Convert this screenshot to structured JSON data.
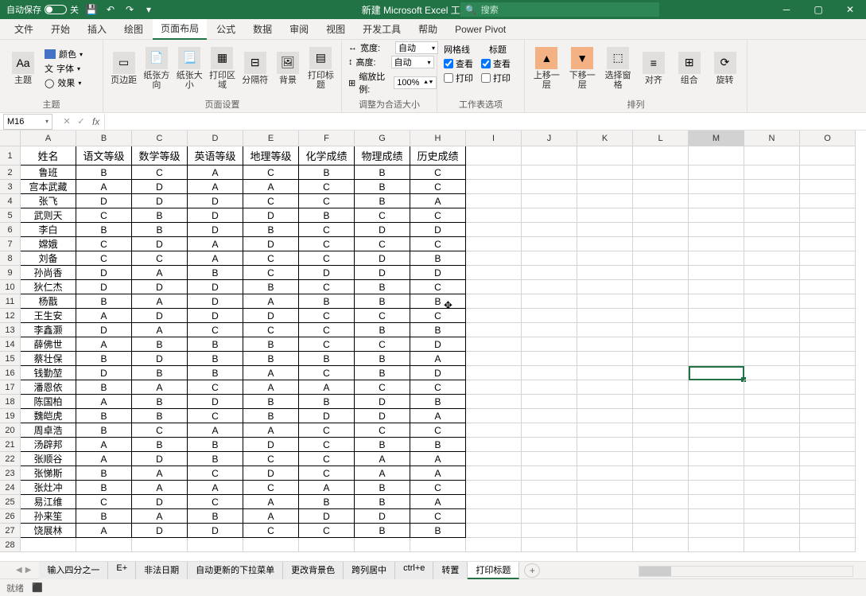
{
  "titlebar": {
    "autosave_label": "自动保存",
    "autosave_state": "关",
    "title": "新建 Microsoft Excel 工作表.xlsx  •",
    "search_placeholder": "搜索"
  },
  "menu": {
    "items": [
      "文件",
      "开始",
      "插入",
      "绘图",
      "页面布局",
      "公式",
      "数据",
      "审阅",
      "视图",
      "开发工具",
      "帮助",
      "Power Pivot"
    ],
    "active_index": 4
  },
  "ribbon": {
    "theme": {
      "button": "主题",
      "colors": "颜色",
      "fonts": "字体",
      "effects": "效果",
      "group": "主题"
    },
    "page_setup": {
      "margins": "页边距",
      "orientation": "纸张方向",
      "size": "纸张大小",
      "print_area": "打印区域",
      "breaks": "分隔符",
      "background": "背景",
      "print_titles": "打印标题",
      "group": "页面设置"
    },
    "scale": {
      "width_label": "宽度:",
      "width_value": "自动",
      "height_label": "高度:",
      "height_value": "自动",
      "scale_label": "缩放比例:",
      "scale_value": "100%",
      "group": "调整为合适大小"
    },
    "sheet_options": {
      "gridlines_label": "网格线",
      "headings_label": "标题",
      "view_label": "查看",
      "print_label": "打印",
      "gridlines_view": true,
      "gridlines_print": false,
      "headings_view": true,
      "headings_print": false,
      "group": "工作表选项"
    },
    "arrange": {
      "bring_forward": "上移一层",
      "send_backward": "下移一层",
      "selection_pane": "选择窗格",
      "align": "对齐",
      "group_btn": "组合",
      "rotate": "旋转",
      "group": "排列"
    }
  },
  "formula_bar": {
    "name_box": "M16",
    "fx": "fx"
  },
  "columns": [
    "A",
    "B",
    "C",
    "D",
    "E",
    "F",
    "G",
    "H",
    "I",
    "J",
    "K",
    "L",
    "M",
    "N",
    "O"
  ],
  "col_widths_data": [
    70,
    70,
    70,
    70,
    70,
    70,
    70,
    70
  ],
  "col_width_empty": 70,
  "headers": [
    "姓名",
    "语文等级",
    "数学等级",
    "英语等级",
    "地理等级",
    "化学成绩",
    "物理成绩",
    "历史成绩"
  ],
  "rows": [
    [
      "鲁班",
      "B",
      "C",
      "A",
      "C",
      "B",
      "B",
      "C"
    ],
    [
      "宫本武藏",
      "A",
      "D",
      "A",
      "A",
      "C",
      "B",
      "C"
    ],
    [
      "张飞",
      "D",
      "D",
      "D",
      "C",
      "C",
      "B",
      "A"
    ],
    [
      "武则天",
      "C",
      "B",
      "D",
      "D",
      "B",
      "C",
      "C"
    ],
    [
      "李白",
      "B",
      "B",
      "D",
      "B",
      "C",
      "D",
      "D"
    ],
    [
      "嫦娥",
      "C",
      "D",
      "A",
      "D",
      "C",
      "C",
      "C"
    ],
    [
      "刘备",
      "C",
      "C",
      "A",
      "C",
      "C",
      "D",
      "B"
    ],
    [
      "孙尚香",
      "D",
      "A",
      "B",
      "C",
      "D",
      "D",
      "D"
    ],
    [
      "狄仁杰",
      "D",
      "D",
      "D",
      "B",
      "C",
      "B",
      "C"
    ],
    [
      "杨戬",
      "B",
      "A",
      "D",
      "A",
      "B",
      "B",
      "B"
    ],
    [
      "王生安",
      "A",
      "D",
      "D",
      "D",
      "C",
      "C",
      "C"
    ],
    [
      "李鑫灏",
      "D",
      "A",
      "C",
      "C",
      "C",
      "B",
      "B"
    ],
    [
      "薛佛世",
      "A",
      "B",
      "B",
      "B",
      "C",
      "C",
      "D"
    ],
    [
      "蔡壮保",
      "B",
      "D",
      "B",
      "B",
      "B",
      "B",
      "A"
    ],
    [
      "钱勤堃",
      "D",
      "B",
      "B",
      "A",
      "C",
      "B",
      "D"
    ],
    [
      "潘恩依",
      "B",
      "A",
      "C",
      "A",
      "A",
      "C",
      "C"
    ],
    [
      "陈国柏",
      "A",
      "B",
      "D",
      "B",
      "B",
      "D",
      "B"
    ],
    [
      "魏皑虎",
      "B",
      "B",
      "C",
      "B",
      "D",
      "D",
      "A"
    ],
    [
      "周卓浩",
      "B",
      "C",
      "A",
      "A",
      "C",
      "C",
      "C"
    ],
    [
      "汤辟邦",
      "A",
      "B",
      "B",
      "D",
      "C",
      "B",
      "B"
    ],
    [
      "张顺谷",
      "A",
      "D",
      "B",
      "C",
      "C",
      "A",
      "A"
    ],
    [
      "张悌斯",
      "B",
      "A",
      "C",
      "D",
      "C",
      "A",
      "A"
    ],
    [
      "张灶冲",
      "B",
      "A",
      "A",
      "C",
      "A",
      "B",
      "C"
    ],
    [
      "易江维",
      "C",
      "D",
      "C",
      "A",
      "B",
      "B",
      "A"
    ],
    [
      "孙来笙",
      "B",
      "A",
      "B",
      "A",
      "D",
      "D",
      "C"
    ],
    [
      "饶展林",
      "A",
      "D",
      "D",
      "C",
      "C",
      "B",
      "B"
    ]
  ],
  "sheet_tabs": {
    "tabs": [
      "输入四分之一",
      "E+",
      "非法日期",
      "自动更新的下拉菜单",
      "更改背景色",
      "跨列居中",
      "ctrl+e",
      "转置",
      "打印标题"
    ],
    "active_index": 8
  },
  "status": {
    "ready": "就绪",
    "rec": "⬛"
  },
  "selected_cell": {
    "col": 12,
    "row": 16
  }
}
